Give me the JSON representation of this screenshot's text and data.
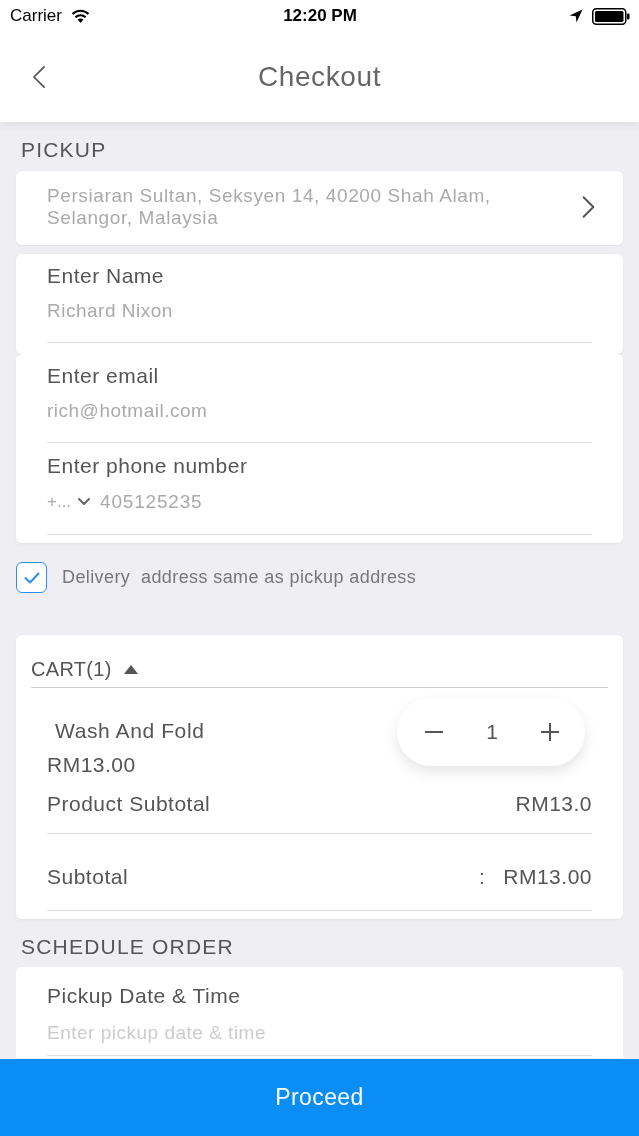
{
  "status_bar": {
    "carrier": "Carrier",
    "time": "12:20 PM"
  },
  "nav": {
    "title": "Checkout"
  },
  "pickup": {
    "heading": "PICKUP",
    "address": "Persiaran Sultan, Seksyen 14, 40200 Shah Alam, Selangor, Malaysia"
  },
  "contact_cards": [
    {
      "fields": [
        {
          "kind": "text",
          "label": "Enter Name",
          "value": "Richard Nixon"
        }
      ]
    },
    {
      "fields": [
        {
          "kind": "text",
          "label": "Enter email",
          "value": "rich@hotmail.com"
        },
        {
          "kind": "phone",
          "label": "Enter phone number",
          "country_code": "+...",
          "value": "405125235"
        }
      ]
    }
  ],
  "same_address": {
    "label": "Delivery  address same as pickup address",
    "checked": true
  },
  "cart": {
    "title": "CART(1)",
    "expanded": true,
    "items": [
      {
        "name": "Wash And Fold",
        "price": "RM13.00",
        "quantity": "1"
      }
    ],
    "product_subtotal": {
      "label": "Product Subtotal",
      "value": "RM13.0"
    },
    "subtotal": {
      "label": "Subtotal",
      "separator": ":",
      "value": "RM13.00"
    }
  },
  "schedule": {
    "heading": "SCHEDULE ORDER",
    "fields": [
      {
        "label": "Pickup Date & Time",
        "placeholder": "Enter pickup date & time"
      }
    ]
  },
  "proceed_button": {
    "label": "Proceed"
  }
}
